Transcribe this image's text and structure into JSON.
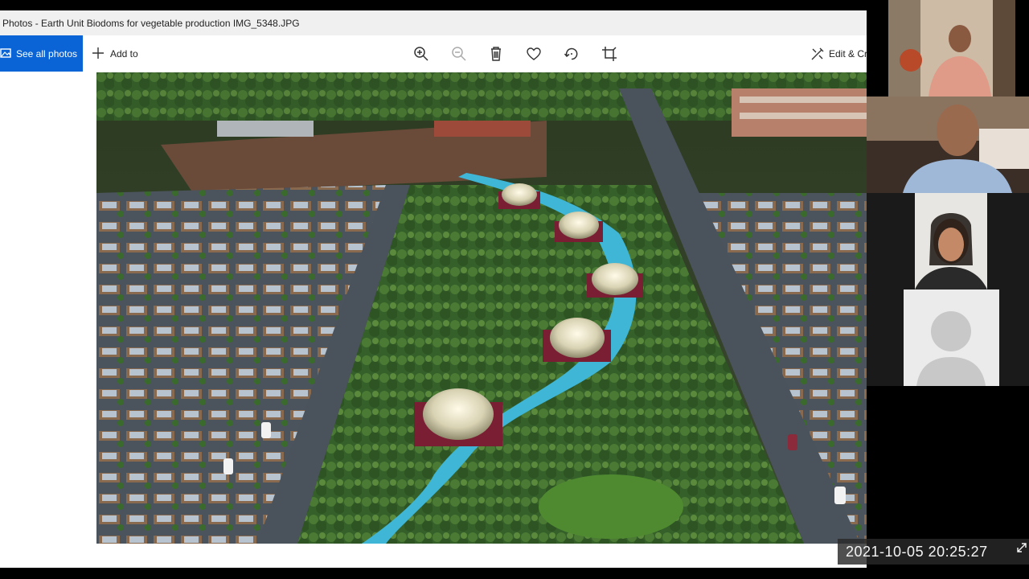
{
  "window": {
    "title": "Photos - Earth Unit Biodoms for vegetable production IMG_5348.JPG"
  },
  "toolbar": {
    "see_all_photos": "See all photos",
    "add_to": "Add to",
    "edit_create": "Edit & Create",
    "icons": [
      "zoom-in-icon",
      "zoom-out-icon",
      "delete-icon",
      "favorite-heart-icon",
      "rotate-icon",
      "crop-icon"
    ]
  },
  "participants": [
    {
      "panel": "participant-video-1"
    },
    {
      "panel": "participant-video-2"
    },
    {
      "panel": "participant-video-3"
    },
    {
      "panel": "participant-video-4-no-camera"
    }
  ],
  "overlay": {
    "timestamp": "2021-10-05  20:25:27"
  },
  "colors": {
    "accent": "#0a64d6",
    "titlebar": "#f0f0f0",
    "canal": "#3fb6d6",
    "greenery": "#3f6e2a",
    "road": "#4a525c"
  }
}
